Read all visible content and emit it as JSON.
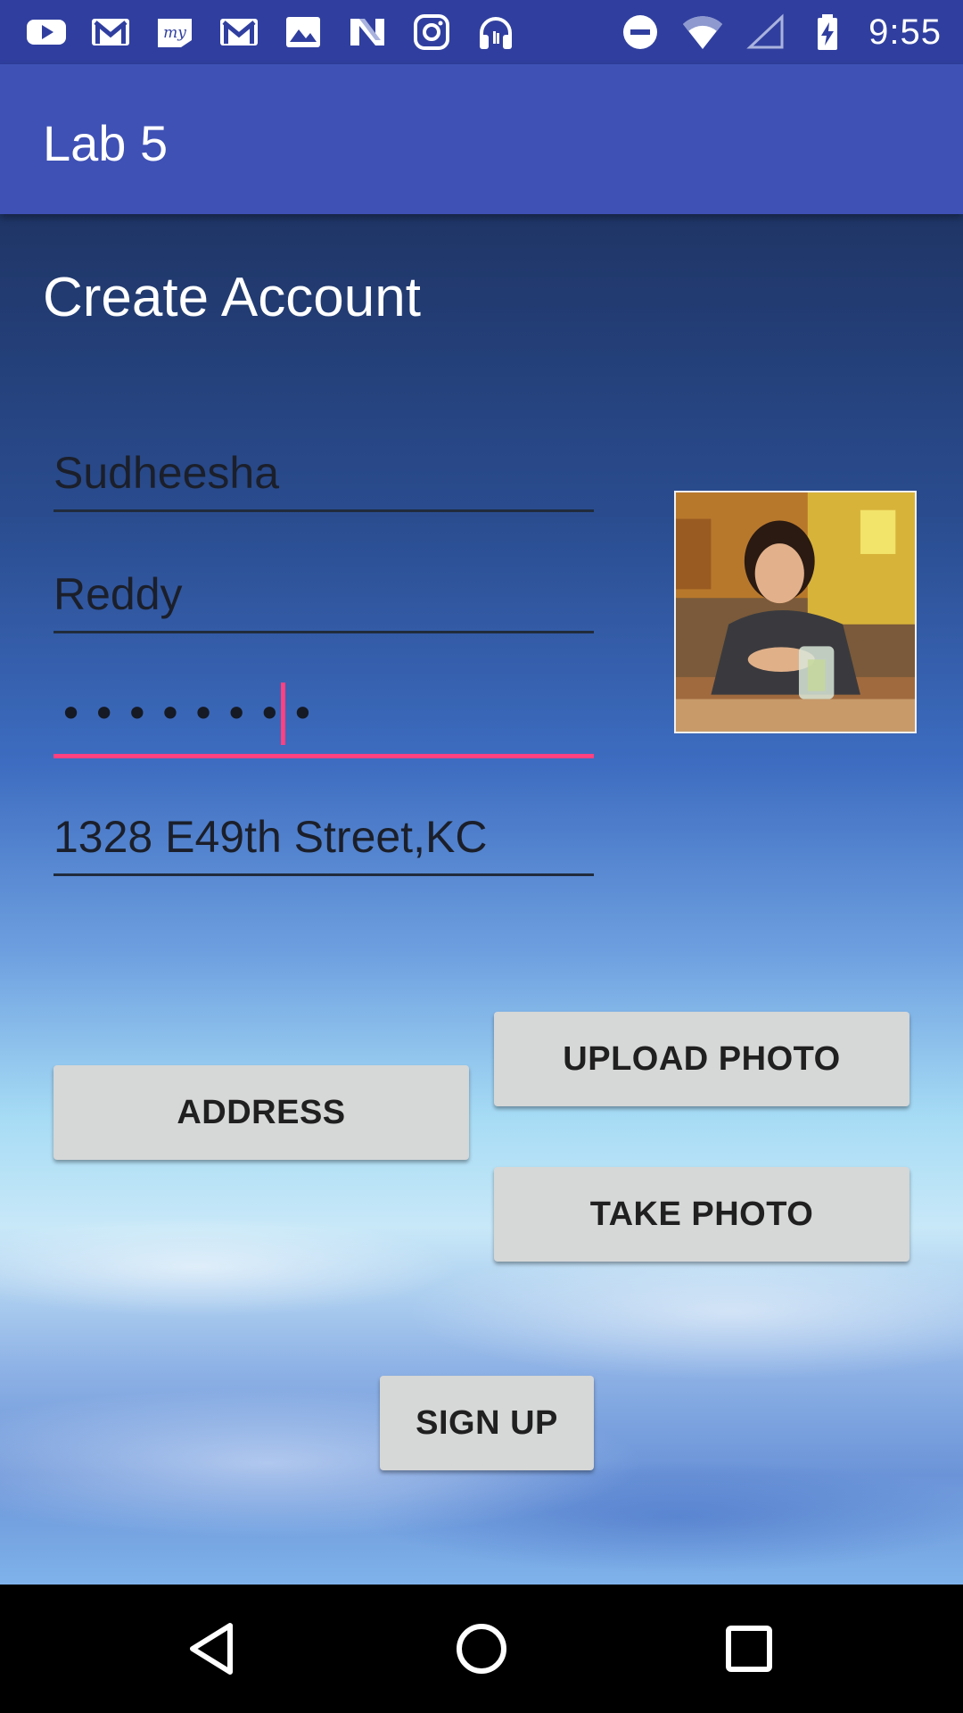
{
  "status_bar": {
    "time": "9:55",
    "notification_icons": [
      "youtube-icon",
      "gmail-icon",
      "mytrip-icon",
      "gmail-icon",
      "gallery-icon",
      "news-icon",
      "instagram-icon",
      "headphones-icon"
    ],
    "system_icons": [
      "do-not-disturb-icon",
      "wifi-icon",
      "cell-signal-icon",
      "battery-charging-icon"
    ]
  },
  "app_bar": {
    "title": "Lab 5",
    "color": "#3f51b5"
  },
  "form": {
    "heading": "Create Account",
    "first_name": "Sudheesha",
    "last_name": "Reddy",
    "password_mask": "••••••••",
    "address": "1328 E49th Street,KC",
    "accent_color": "#ff4081"
  },
  "profile_photo": {
    "icon": "profile-photo"
  },
  "buttons": {
    "address": "ADDRESS",
    "upload_photo": "UPLOAD PHOTO",
    "take_photo": "TAKE PHOTO",
    "sign_up": "SIGN UP"
  },
  "nav_bar": {
    "icons": [
      "back-icon",
      "home-icon",
      "recents-icon"
    ]
  }
}
